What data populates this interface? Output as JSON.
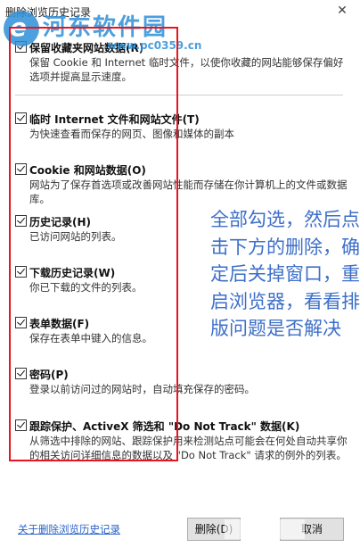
{
  "window": {
    "title": "删除浏览历史记录",
    "close_glyph": "✕"
  },
  "watermark": {
    "name": "河东软件园",
    "url": "www.pc0359.cn"
  },
  "options": [
    {
      "label": "保留收藏夹网站数据(R)",
      "description": "保留 Cookie 和 Internet 临时文件，以使你收藏的网站能够保存偏好选项并提高显示速度。",
      "checked": true
    },
    {
      "label": "临时 Internet 文件和网站文件(T)",
      "description": "为快速查看而保存的网页、图像和媒体的副本",
      "checked": true
    },
    {
      "label": "Cookie 和网站数据(O)",
      "description": "网站为了保存首选项或改善网站性能而存储在你计算机上的文件或数据库。",
      "checked": true
    },
    {
      "label": "历史记录(H)",
      "description": "已访问网站的列表。",
      "checked": true
    },
    {
      "label": "下载历史记录(W)",
      "description": "你已下载的文件的列表。",
      "checked": true
    },
    {
      "label": "表单数据(F)",
      "description": "保存在表单中键入的信息。",
      "checked": true
    },
    {
      "label": "密码(P)",
      "description": "登录以前访问过的网站时，自动填充保存的密码。",
      "checked": true
    },
    {
      "label": "跟踪保护、ActiveX 筛选和 \"Do Not Track\" 数据(K)",
      "description": "从筛选中排除的网站、跟踪保护用来检测站点可能会在何处自动共享你的相关访问详细信息的数据以及 \"Do Not Track\" 请求的例外的列表。",
      "checked": true
    }
  ],
  "annotation": {
    "text": "全部勾选，然后点击下方的删除，确定后关掉窗口，重启浏览器，看看排版问题是否解决",
    "color": "#3d6fc9"
  },
  "footer": {
    "about_link": "关于删除浏览历史记录",
    "delete_button": "删除(D)",
    "cancel_button": "取消"
  },
  "colors": {
    "highlight_frame": "#e8141e",
    "link": "#2a62c9"
  }
}
